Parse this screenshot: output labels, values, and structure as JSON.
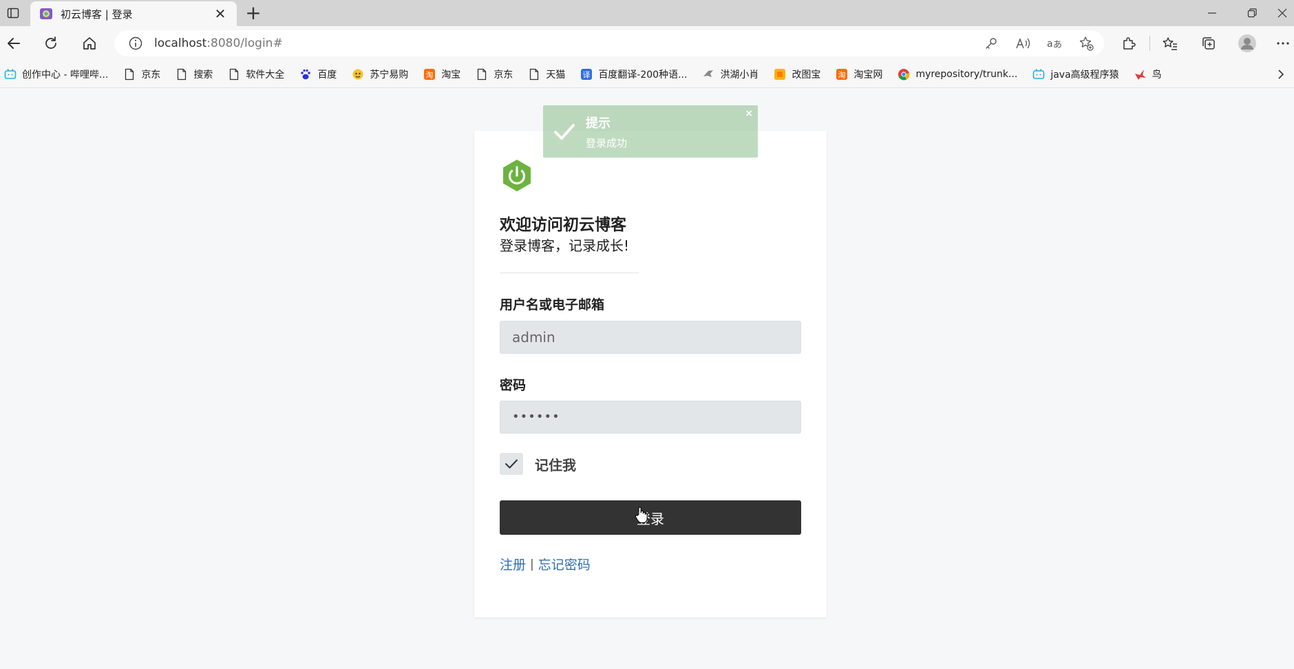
{
  "browser": {
    "tab_title": "初云博客 | 登录",
    "url_host": "localhost",
    "url_rest": ":8080/login#",
    "new_tab_label": "+",
    "close_tab_label": "✕"
  },
  "bookmarks": [
    {
      "label": "创作中心 - 哔哩哔...",
      "icon": "bilibili-icon"
    },
    {
      "label": "京东",
      "icon": "page-icon"
    },
    {
      "label": "搜索",
      "icon": "page-icon"
    },
    {
      "label": "软件大全",
      "icon": "page-icon"
    },
    {
      "label": "百度",
      "icon": "baidu-icon"
    },
    {
      "label": "苏宁易购",
      "icon": "suning-icon"
    },
    {
      "label": "淘宝",
      "icon": "taobao-icon"
    },
    {
      "label": "京东",
      "icon": "page-icon"
    },
    {
      "label": "天猫",
      "icon": "page-icon"
    },
    {
      "label": "百度翻译-200种语...",
      "icon": "translate-icon"
    },
    {
      "label": "洪湖小肖",
      "icon": "bird-icon"
    },
    {
      "label": "改图宝",
      "icon": "gaitubao-icon"
    },
    {
      "label": "淘宝网",
      "icon": "taobao-icon"
    },
    {
      "label": "myrepository/trunk...",
      "icon": "chrome-icon"
    },
    {
      "label": "java高级程序猿",
      "icon": "bilibili-icon"
    },
    {
      "label": "鸟",
      "icon": "bird-red-icon"
    }
  ],
  "login": {
    "welcome": "欢迎访问初云博客",
    "subtitle": "登录博客，记录成长!",
    "username_label": "用户名或电子邮箱",
    "username_value": "admin",
    "password_label": "密码",
    "password_value": "••••••",
    "remember_label": "记住我",
    "remember_checked": true,
    "submit_label": "登录",
    "register_link": "注册",
    "separator": "|",
    "forgot_link": "忘记密码"
  },
  "toast": {
    "title": "提示",
    "message": "登录成功",
    "close": "×"
  },
  "colors": {
    "brand_green": "#6db33f",
    "button_dark": "#333333",
    "link_blue": "#2f6fb3",
    "toast_green": "#8bbe8b"
  }
}
